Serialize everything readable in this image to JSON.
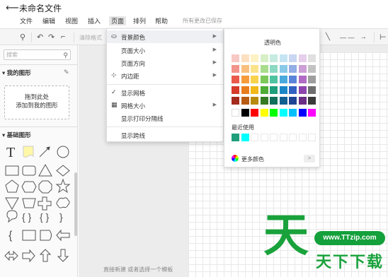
{
  "title": "未命名文件",
  "menu": [
    "文件",
    "编辑",
    "视图",
    "插入",
    "页面",
    "排列",
    "帮助"
  ],
  "save_status": "所有更改已保存",
  "toolbar": {
    "clear_format": "清除格式"
  },
  "left": {
    "search_placeholder": "搜索",
    "my_shapes": "我的图形",
    "drop_hint_1": "拖到此处",
    "drop_hint_2": "添加到我的图形",
    "basic_shapes": "基础图形",
    "text_shape": "T"
  },
  "page_menu": {
    "items": [
      {
        "icon": "paint-bucket-icon",
        "label": "背景颜色",
        "arrow": true
      },
      {
        "icon": "",
        "label": "页面大小",
        "arrow": true
      },
      {
        "icon": "",
        "label": "页面方向",
        "arrow": true
      },
      {
        "icon": "padding-icon",
        "label": "内边距",
        "arrow": true
      },
      {
        "icon": "check-icon",
        "label": "显示网格",
        "arrow": false
      },
      {
        "icon": "grid-icon",
        "label": "网格大小",
        "arrow": true
      },
      {
        "icon": "",
        "label": "显示打印分隔线",
        "arrow": false
      },
      {
        "icon": "",
        "label": "显示跨线",
        "arrow": false
      }
    ]
  },
  "color_panel": {
    "transparent_label": "透明色",
    "recent_label": "最近使用",
    "more_colors": "更多颜色",
    "palette": [
      [
        "#f8c9c4",
        "#fce0c0",
        "#fdf2c4",
        "#d7efc6",
        "#c6ebe0",
        "#c5e4f3",
        "#c9d6f2",
        "#e6cfea",
        "#e0e0e0"
      ],
      [
        "#f2948a",
        "#f9bf7f",
        "#fbe38a",
        "#a9dc8c",
        "#8cd9c3",
        "#8ac8e8",
        "#93ade6",
        "#cc9fd6",
        "#c2c2c2"
      ],
      [
        "#ea5a4a",
        "#f59b3a",
        "#f8d24c",
        "#7cc95a",
        "#4fc2a0",
        "#4aa9dd",
        "#5b84d9",
        "#b06cc4",
        "#9e9e9e"
      ],
      [
        "#d63b2c",
        "#e97d1b",
        "#f0b918",
        "#4fac35",
        "#1e9e7a",
        "#1a86c7",
        "#3261c2",
        "#8e44ad",
        "#6e6e6e"
      ],
      [
        "#a52a1e",
        "#b75c12",
        "#b88b10",
        "#357a22",
        "#12705a",
        "#105f91",
        "#1f4493",
        "#6a2f84",
        "#3a3a3a"
      ]
    ],
    "standard": [
      "#ffffff",
      "#000000",
      "#ff0000",
      "#ffff00",
      "#00ff00",
      "#00ffff",
      "#00bfff",
      "#0000ff",
      "#ff00ff"
    ],
    "recent": [
      "#1e9e7a",
      "#00ffff",
      "#ffffff",
      "#ffffff",
      "#ffffff",
      "#ffffff",
      "#ffffff",
      "#ffffff",
      "#ffffff"
    ]
  },
  "canvas_hint": "直接新建 或者选择一个模板",
  "watermark": {
    "big": "天",
    "url": "www.TTzip.com",
    "text": "天下下载"
  }
}
